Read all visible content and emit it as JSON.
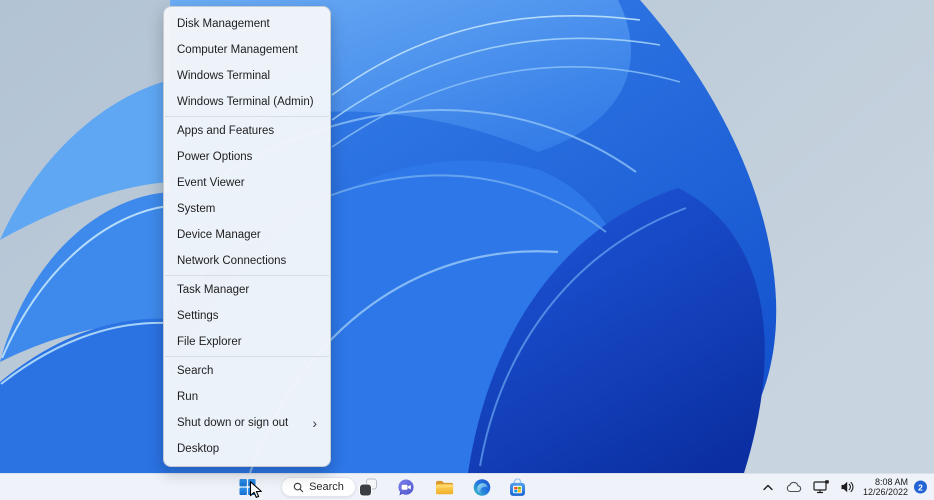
{
  "context_menu": {
    "groups": [
      {
        "items": [
          "Disk Management",
          "Computer Management",
          "Windows Terminal",
          "Windows Terminal (Admin)"
        ]
      },
      {
        "items": [
          "Apps and Features",
          "Power Options",
          "Event Viewer",
          "System",
          "Device Manager",
          "Network Connections"
        ]
      },
      {
        "items": [
          "Task Manager",
          "Settings",
          "File Explorer"
        ]
      },
      {
        "items": [
          "Search",
          "Run",
          "Shut down or sign out",
          "Desktop"
        ]
      }
    ],
    "submenu_indicator": "›"
  },
  "taskbar": {
    "search_label": "Search",
    "app_icons": [
      "start",
      "task-view",
      "chat",
      "file-explorer",
      "edge",
      "microsoft-store"
    ],
    "tray_icons": [
      "hidden-icons-chevron",
      "onedrive",
      "network",
      "volume"
    ],
    "clock": {
      "time": "8:08 AM",
      "date": "12/26/2022"
    },
    "notification_badge": "2"
  },
  "colors": {
    "taskbar_bg": "#eff3f9",
    "menu_bg": "#f3f6fa",
    "start_blue": "#1f7fe0",
    "badge_blue": "#2563d4",
    "bloom_dark_blue": "#0b2fa2",
    "bloom_mid_blue": "#1250cc",
    "bloom_light_blue": "#5fa7f3",
    "wallpaper_bg": "#bccbdb"
  }
}
